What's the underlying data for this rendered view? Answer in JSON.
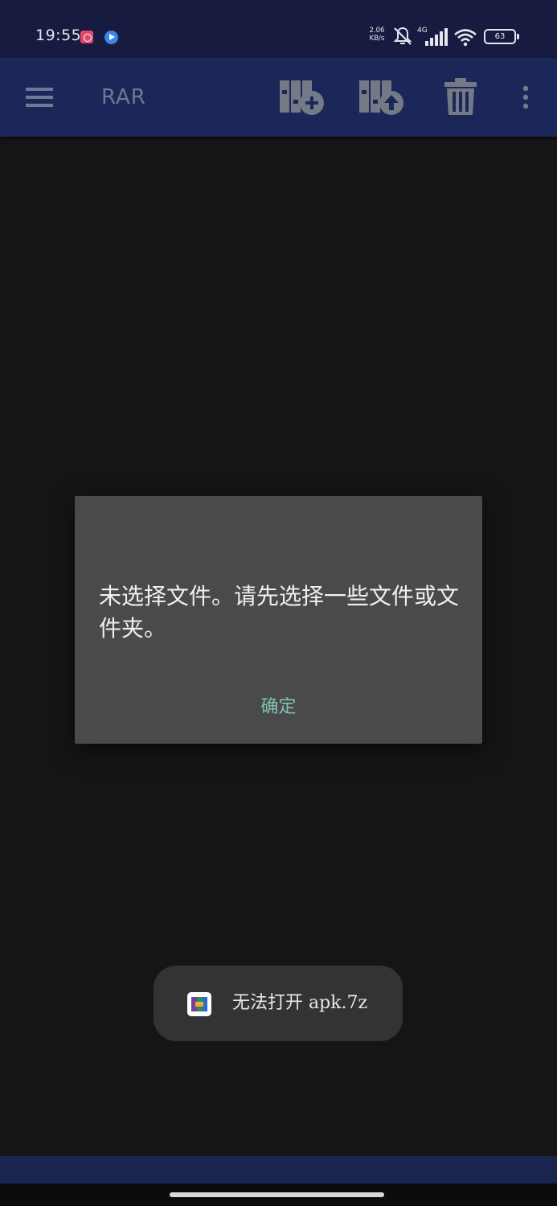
{
  "status_bar": {
    "time": "19:55",
    "net_speed_value": "2.06",
    "net_speed_unit": "KB/s",
    "network_type": "4G",
    "battery_level": "63",
    "icons": [
      "app-notification-icon",
      "video-notification-icon",
      "mute-icon",
      "signal-icon",
      "wifi-icon",
      "battery-icon"
    ]
  },
  "toolbar": {
    "title": "RAR",
    "icons": [
      "menu-icon",
      "add-to-archive-icon",
      "extract-icon",
      "delete-icon",
      "more-options-icon"
    ]
  },
  "dialog": {
    "message": "未选择文件。请先选择一些文件或文件夹。",
    "ok_label": "确定",
    "ok_color": "#7fc2b5"
  },
  "toast": {
    "message": "无法打开 apk.7z",
    "icon": "rar-app-icon"
  },
  "colors": {
    "status_bar": "#171b3f",
    "toolbar": "#1c2759",
    "background": "#151515",
    "dialog": "#4a4a4a",
    "toast": "#333333"
  }
}
